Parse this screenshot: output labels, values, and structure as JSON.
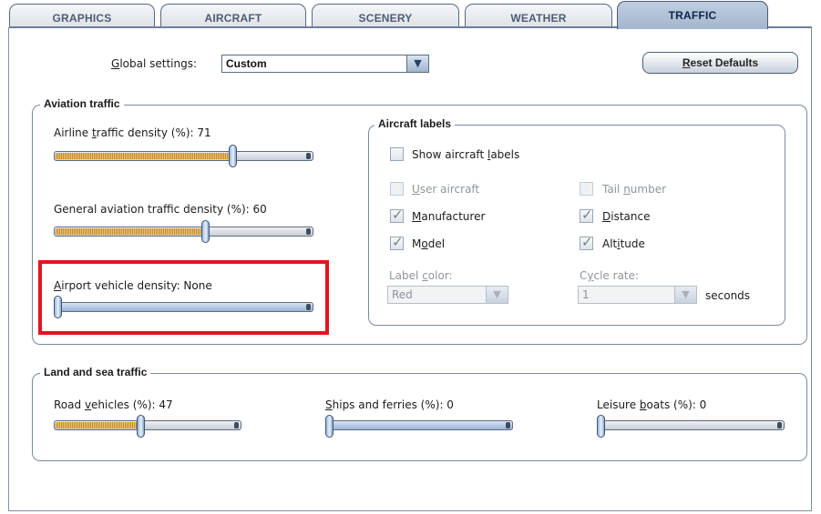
{
  "tabs": [
    {
      "label": "GRAPHICS",
      "active": false
    },
    {
      "label": "AIRCRAFT",
      "active": false
    },
    {
      "label": "SCENERY",
      "active": false
    },
    {
      "label": "WEATHER",
      "active": false
    },
    {
      "label": "TRAFFIC",
      "active": true
    }
  ],
  "global": {
    "label_pre": "",
    "label_u": "G",
    "label_post": "lobal settings:",
    "value": "Custom",
    "reset_u": "R",
    "reset_post": "eset Defaults"
  },
  "aviation": {
    "title": "Aviation traffic",
    "airline": {
      "pre": "Airline ",
      "u": "t",
      "post": "raffic density (%): 71",
      "value": 71
    },
    "general": {
      "pre": "General aviation traf",
      "u": "f",
      "post": "ic density (%): 60",
      "value": 60
    },
    "airport": {
      "pre": "",
      "u": "A",
      "post": "irport vehicle density: None",
      "value": 0
    }
  },
  "labels": {
    "title": "Aircraft labels",
    "show": {
      "pre": "Show aircraft ",
      "u": "l",
      "post": "abels",
      "checked": false
    },
    "user_aircraft": {
      "pre": "",
      "u": "U",
      "post": "ser aircraft",
      "checked": false,
      "enabled": false
    },
    "tail_number": {
      "pre": "Tail ",
      "u": "n",
      "post": "umber",
      "checked": false,
      "enabled": false
    },
    "manufacturer": {
      "pre": "",
      "u": "M",
      "post": "anufacturer",
      "checked": true
    },
    "distance": {
      "pre": "",
      "u": "D",
      "post": "istance",
      "checked": true
    },
    "model": {
      "pre": "M",
      "u": "o",
      "post": "del",
      "checked": true
    },
    "altitude": {
      "pre": "Alt",
      "u": "i",
      "post": "tude",
      "checked": true
    },
    "label_color": {
      "pre": "Label ",
      "u": "c",
      "post": "olor:",
      "value": "Red"
    },
    "cycle_rate": {
      "pre": "C",
      "u": "y",
      "post": "cle rate:",
      "value": "1",
      "unit": "seconds"
    }
  },
  "land_sea": {
    "title": "Land and sea traffic",
    "road": {
      "pre": "Road ",
      "u": "v",
      "post": "ehicles (%): 47",
      "value": 47
    },
    "ships": {
      "pre": "",
      "u": "S",
      "post": "hips and ferries (%): 0",
      "value": 0
    },
    "leisure": {
      "pre": "Leisure ",
      "u": "b",
      "post": "oats (%): 0",
      "value": 0
    }
  },
  "icons": {
    "dropdown": "chevron-down-icon",
    "check": "checkmark-icon"
  },
  "colors": {
    "highlight": "#e2141e",
    "slider_fill": "#f0c46d",
    "active_tab": "#a3b6cf"
  }
}
